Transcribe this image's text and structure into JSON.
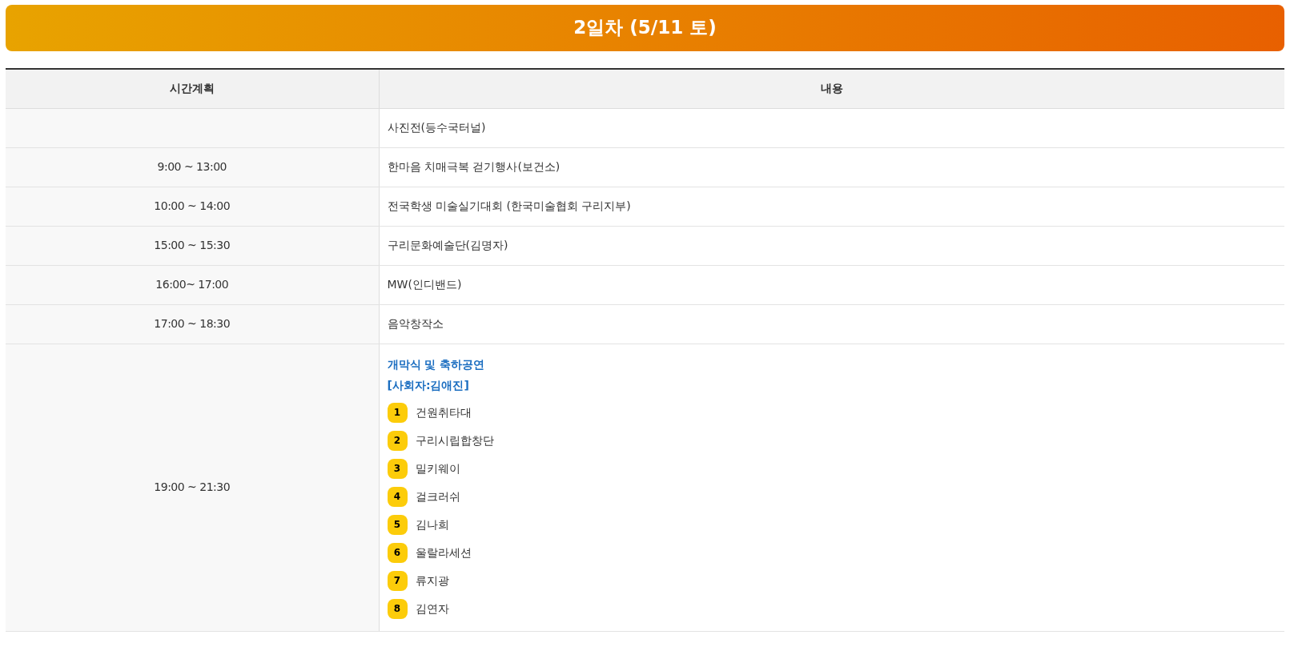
{
  "banner": {
    "title": "2일차 (5/11 토)"
  },
  "table": {
    "columns": [
      "시간계획",
      "내용"
    ],
    "rows": [
      {
        "time": "",
        "content": "사진전(등수국터널)"
      },
      {
        "time": "9:00 ~ 13:00",
        "content": "한마음 치매극복 걷기행사(보건소)"
      },
      {
        "time": "10:00 ~ 14:00",
        "content": "전국학생 미술실기대회 (한국미술협회 구리지부)"
      },
      {
        "time": "15:00 ~ 15:30",
        "content": "구리문화예술단(김명자)"
      },
      {
        "time": "16:00~ 17:00",
        "content": "MW(인디밴드)"
      },
      {
        "time": "17:00 ~ 18:30",
        "content": "음악창작소"
      },
      {
        "time": "19:00 ~ 21:30",
        "heading": [
          "개막식 및 축하공연",
          "[사회자:김애진]"
        ],
        "items": [
          {
            "number": "1",
            "name": "건원취타대"
          },
          {
            "number": "2",
            "name": "구리시립합창단"
          },
          {
            "number": "3",
            "name": "밀키웨이"
          },
          {
            "number": "4",
            "name": "걸크러쉬"
          },
          {
            "number": "5",
            "name": "김나희"
          },
          {
            "number": "6",
            "name": "울랄라세션"
          },
          {
            "number": "7",
            "name": "류지광"
          },
          {
            "number": "8",
            "name": "김연자"
          }
        ]
      }
    ]
  }
}
